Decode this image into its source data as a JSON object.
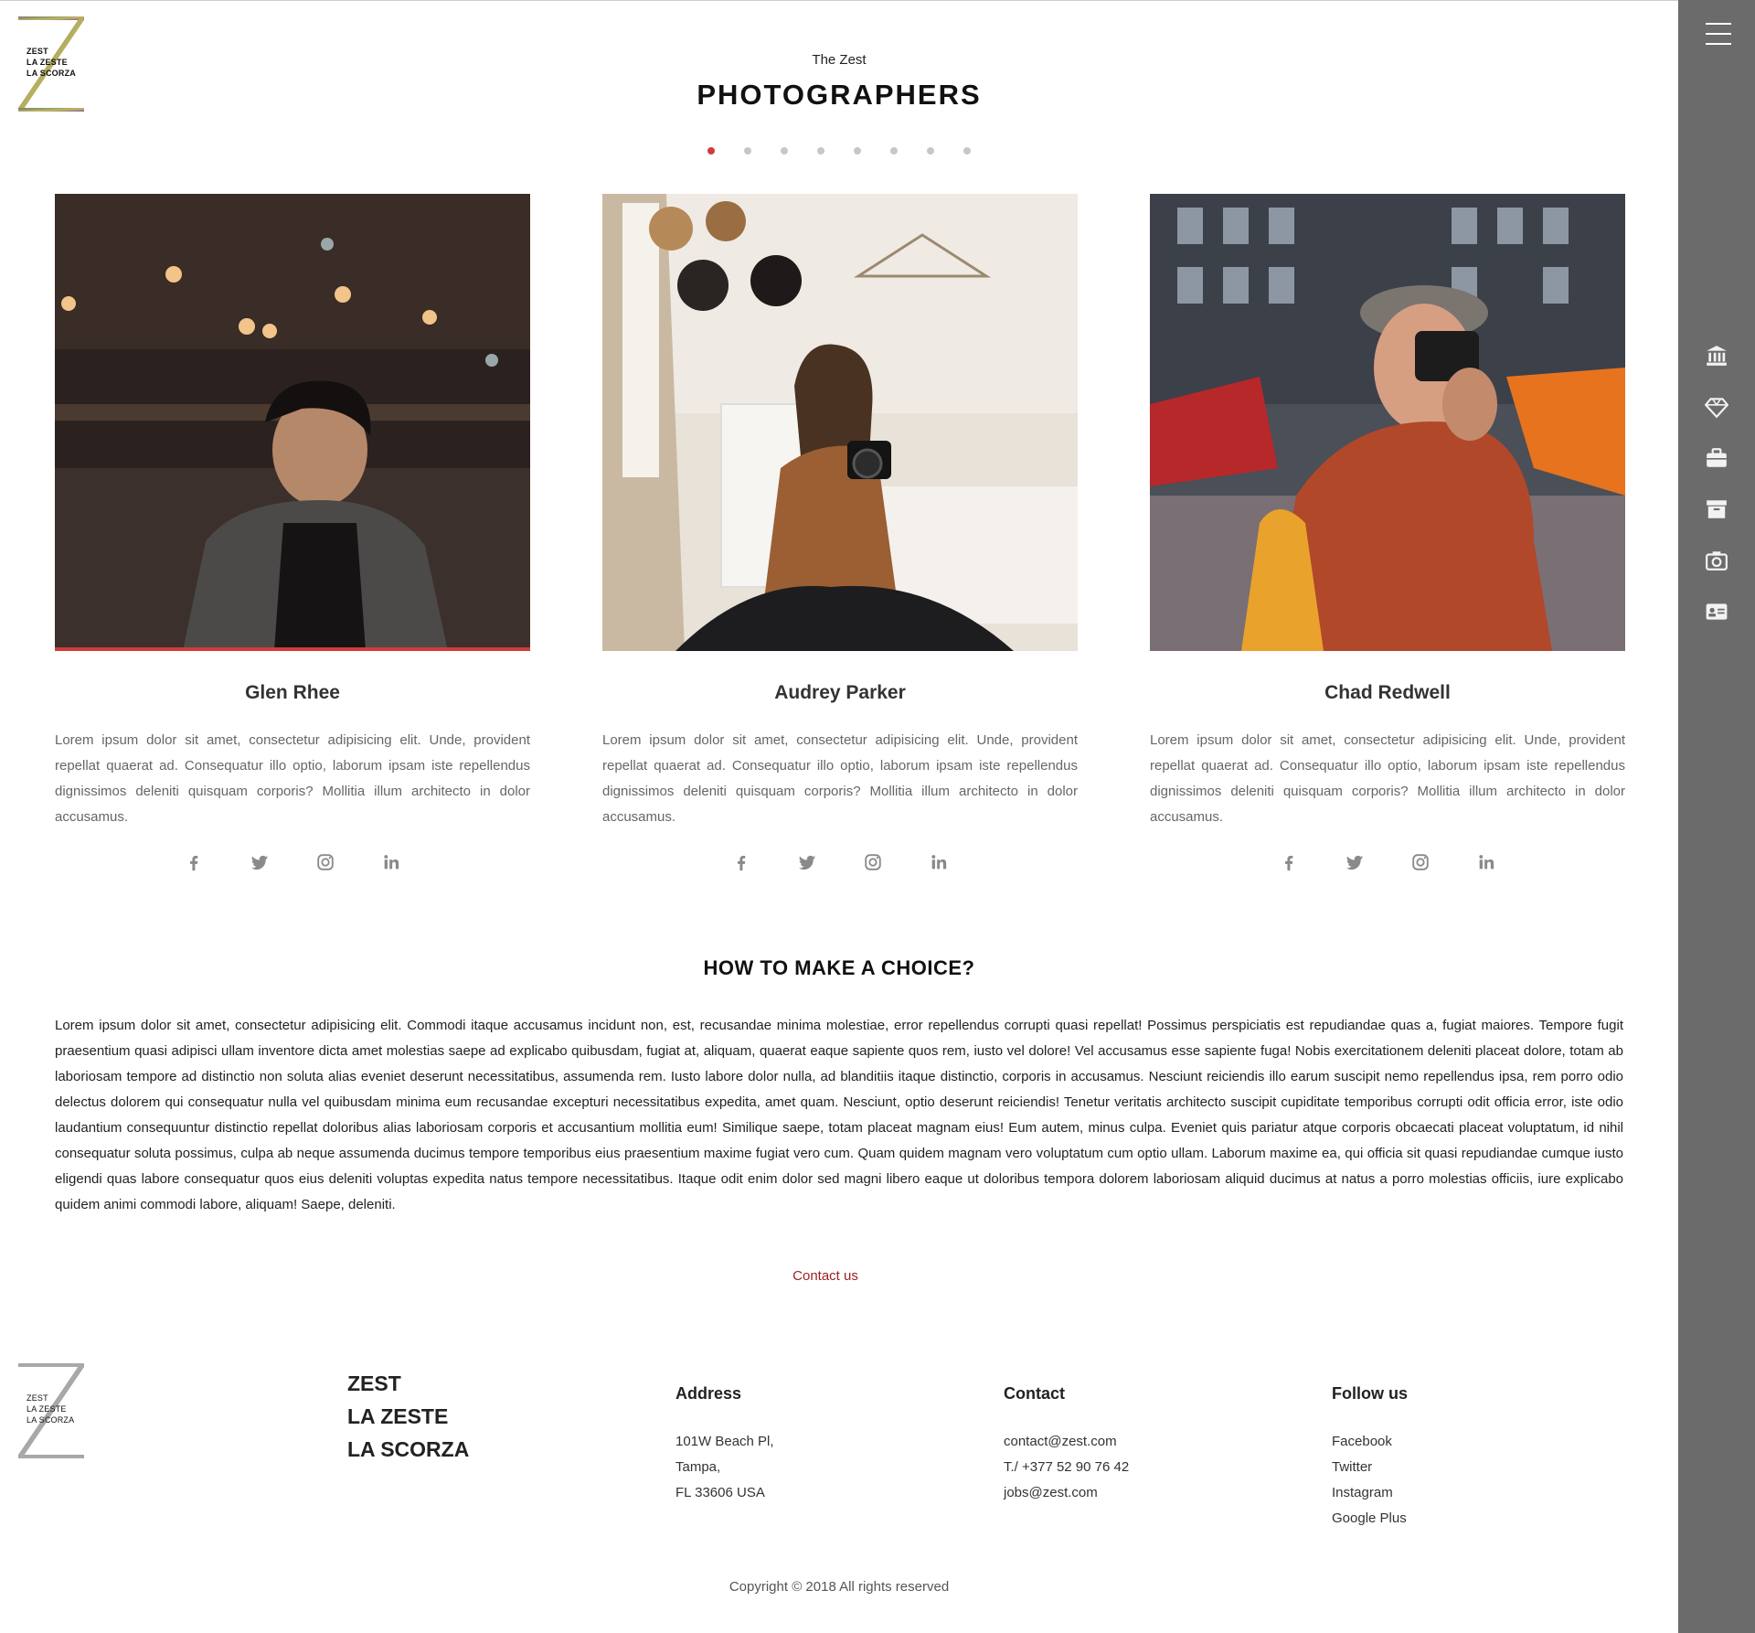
{
  "header": {
    "subtitle": "The Zest",
    "title": "PHOTOGRAPHERS",
    "slider_dots": 8,
    "active_dot": 0
  },
  "logo": {
    "lines": [
      "ZEST",
      "LA ZESTE",
      "LA SCORZA"
    ]
  },
  "rail": {
    "menu_icon": "hamburger-icon",
    "icons": [
      "bank-icon",
      "diamond-icon",
      "briefcase-icon",
      "archive-icon",
      "camera-icon",
      "id-card-icon"
    ]
  },
  "photographers": [
    {
      "name": "Glen Rhee",
      "bio": "Lorem ipsum dolor sit amet, consectetur adipisicing elit. Unde, provident repellat quaerat ad. Consequatur illo optio, laborum ipsam iste repellendus dignissimos deleniti quisquam corporis? Mollitia illum architecto in dolor accusamus.",
      "active": true
    },
    {
      "name": "Audrey Parker",
      "bio": "Lorem ipsum dolor sit amet, consectetur adipisicing elit. Unde, provident repellat quaerat ad. Consequatur illo optio, laborum ipsam iste repellendus dignissimos deleniti quisquam corporis? Mollitia illum architecto in dolor accusamus.",
      "active": false
    },
    {
      "name": "Chad Redwell",
      "bio": "Lorem ipsum dolor sit amet, consectetur adipisicing elit. Unde, provident repellat quaerat ad. Consequatur illo optio, laborum ipsam iste repellendus dignissimos deleniti quisquam corporis? Mollitia illum architecto in dolor accusamus.",
      "active": false
    }
  ],
  "social_icons": [
    "facebook-icon",
    "twitter-icon",
    "instagram-icon",
    "linkedin-icon"
  ],
  "choice": {
    "title": "HOW TO MAKE A CHOICE?",
    "text": "Lorem ipsum dolor sit amet, consectetur adipisicing elit. Commodi itaque accusamus incidunt non, est, recusandae minima molestiae, error repellendus corrupti quasi repellat! Possimus perspiciatis est repudiandae quas a, fugiat maiores. Tempore fugit praesentium quasi adipisci ullam inventore dicta amet molestias saepe ad explicabo quibusdam, fugiat at, aliquam, quaerat eaque sapiente quos rem, iusto vel dolore! Vel accusamus esse sapiente fuga! Nobis exercitationem deleniti placeat dolore, totam ab laboriosam tempore ad distinctio non soluta alias eveniet deserunt necessitatibus, assumenda rem. Iusto labore dolor nulla, ad blanditiis itaque distinctio, corporis in accusamus. Nesciunt reiciendis illo earum suscipit nemo repellendus ipsa, rem porro odio delectus dolorem qui consequatur nulla vel quibusdam minima eum recusandae excepturi necessitatibus expedita, amet quam. Nesciunt, optio deserunt reiciendis! Tenetur veritatis architecto suscipit cupiditate temporibus corrupti odit officia error, iste odio laudantium consequuntur distinctio repellat doloribus alias laboriosam corporis et accusantium mollitia eum! Similique saepe, totam placeat magnam eius! Eum autem, minus culpa. Eveniet quis pariatur atque corporis obcaecati placeat voluptatum, id nihil consequatur soluta possimus, culpa ab neque assumenda ducimus tempore temporibus eius praesentium maxime fugiat vero cum. Quam quidem magnam vero voluptatum cum optio ullam. Laborum maxime ea, qui officia sit quasi repudiandae cumque iusto eligendi quas labore consequatur quos eius deleniti voluptas expedita natus tempore necessitatibus. Itaque odit enim dolor sed magni libero eaque ut doloribus tempora dolorem laboriosam aliquid ducimus at natus a porro molestias officiis, iure explicabo quidem animi commodi labore, aliquam! Saepe, deleniti.",
    "contact_label": "Contact us"
  },
  "footer": {
    "brand": [
      "ZEST",
      "LA ZESTE",
      "LA SCORZA"
    ],
    "address": {
      "title": "Address",
      "lines": [
        "101W Beach Pl,",
        "Tampa,",
        "FL 33606 USA"
      ]
    },
    "contact": {
      "title": "Contact",
      "lines": [
        "contact@zest.com",
        "T./ +377 52 90 76 42",
        "jobs@zest.com"
      ]
    },
    "follow": {
      "title": "Follow us",
      "links": [
        "Facebook",
        "Twitter",
        "Instagram",
        "Google Plus"
      ]
    },
    "copyright": "Copyright © 2018 All rights reserved"
  },
  "colors": {
    "accent_red": "#d23b3b",
    "link_red": "#9b1f1f",
    "rail_gray": "#6b6b6b"
  }
}
